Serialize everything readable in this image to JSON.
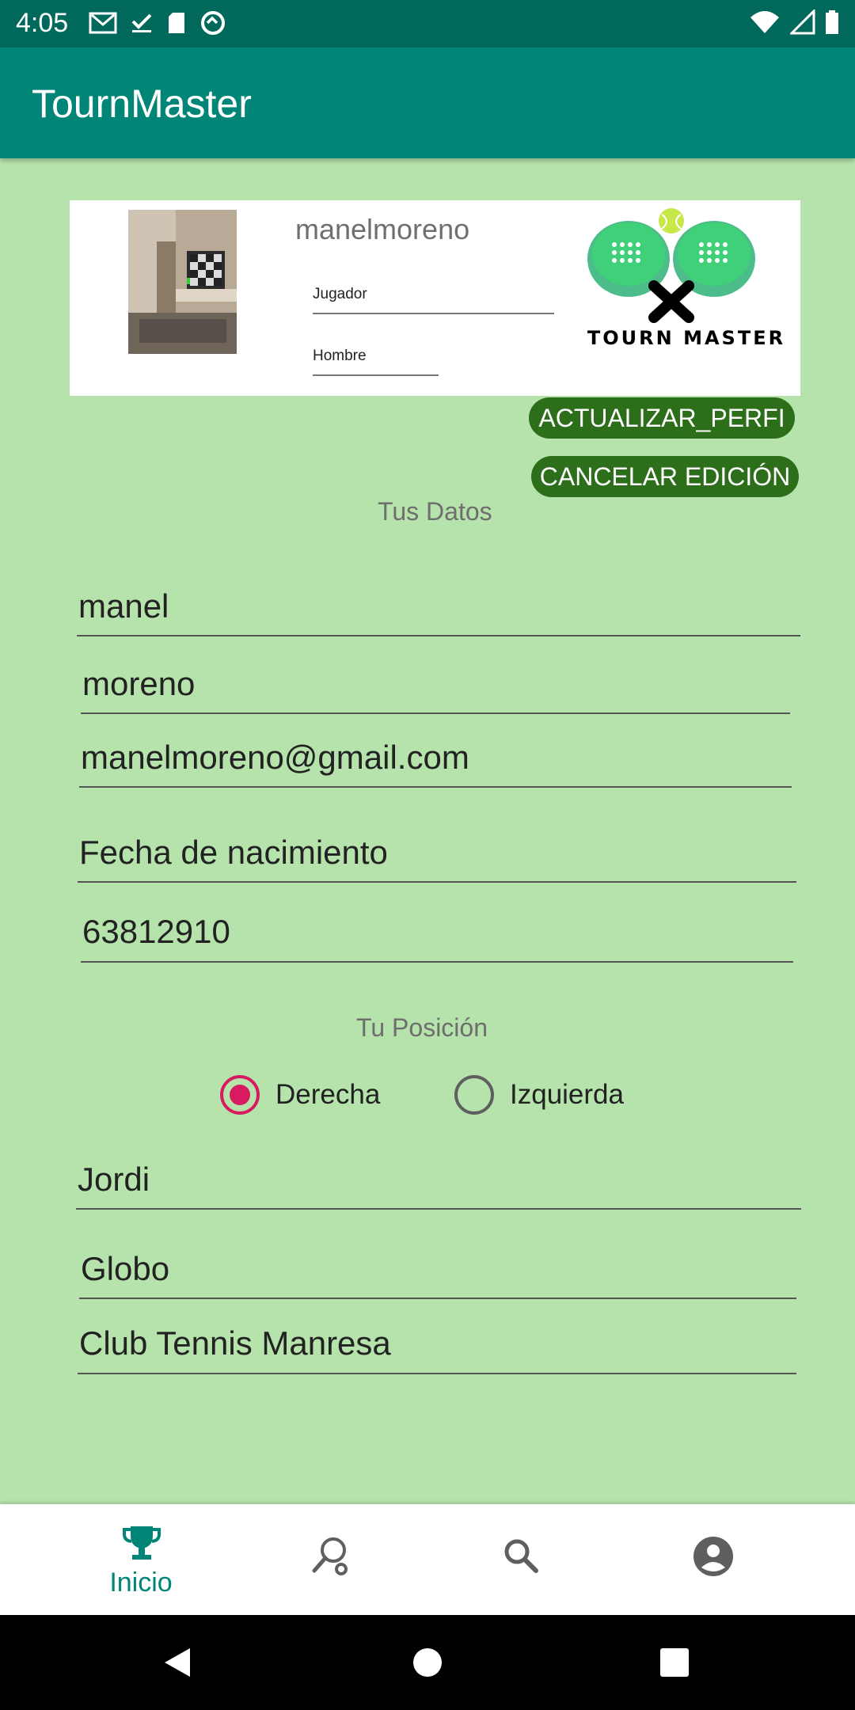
{
  "status_bar": {
    "time": "4:05",
    "left_icons": [
      "gmail-icon",
      "check-icon",
      "sd-card-icon",
      "sync-icon"
    ],
    "right_icons": [
      "wifi-icon",
      "signal-icon",
      "battery-icon"
    ]
  },
  "app_bar": {
    "title": "TournMaster"
  },
  "profile": {
    "username": "manelmoreno",
    "role": "Jugador",
    "gender": "Hombre",
    "logo_text": "TOURN MASTER"
  },
  "buttons": {
    "update": "ACTUALIZAR_PERFI",
    "cancel": "CANCELAR EDICIÓN"
  },
  "sections": {
    "tus_datos": "Tus Datos",
    "tu_posicion": "Tu Posición"
  },
  "fields": {
    "first_name": "manel",
    "last_name": "moreno",
    "email": "manelmoreno@gmail.com",
    "birth_date": "Fecha de nacimiento",
    "phone": "63812910",
    "partner": "Jordi",
    "favorite_shot": "Globo",
    "club": "Club Tennis Manresa"
  },
  "position": {
    "options": [
      "Derecha",
      "Izquierda"
    ],
    "selected": "Derecha"
  },
  "bottom_nav": {
    "items": [
      {
        "icon": "trophy-icon",
        "label": "Inicio",
        "active": true
      },
      {
        "icon": "racket-icon",
        "label": ""
      },
      {
        "icon": "search-icon",
        "label": ""
      },
      {
        "icon": "account-icon",
        "label": ""
      }
    ],
    "active_color": "#008577"
  },
  "colors": {
    "status_bar": "#00695c",
    "app_bar": "#008577",
    "background": "#b5e3ab",
    "button": "#2d6e1a",
    "radio_checked": "#d81b60"
  }
}
